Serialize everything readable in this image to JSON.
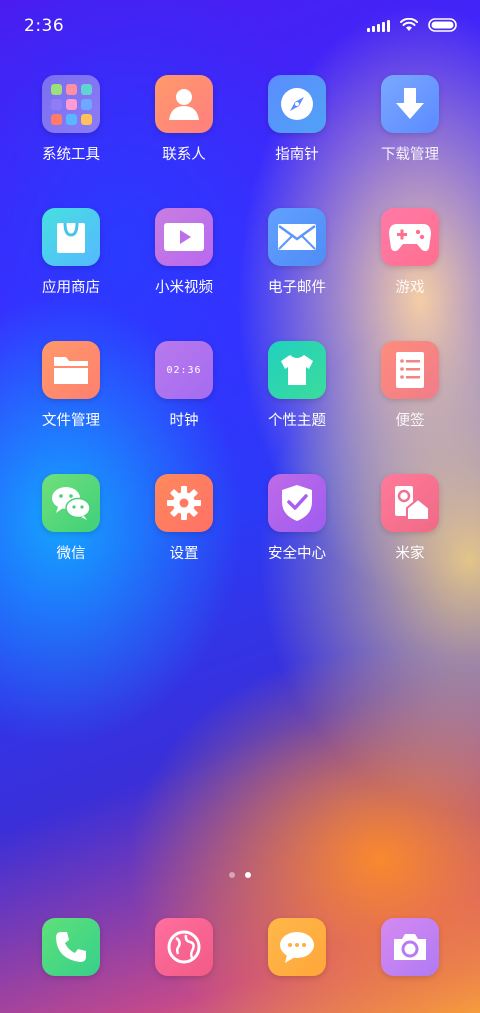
{
  "status_bar": {
    "time": "2:36"
  },
  "apps": [
    {
      "label": "系统工具",
      "icon": "folder-icon"
    },
    {
      "label": "联系人",
      "icon": "contacts-icon"
    },
    {
      "label": "指南针",
      "icon": "compass-icon"
    },
    {
      "label": "下载管理",
      "icon": "download-icon"
    },
    {
      "label": "应用商店",
      "icon": "shopping-bag-icon"
    },
    {
      "label": "小米视频",
      "icon": "video-icon"
    },
    {
      "label": "电子邮件",
      "icon": "mail-icon"
    },
    {
      "label": "游戏",
      "icon": "gamepad-icon"
    },
    {
      "label": "文件管理",
      "icon": "file-folder-icon"
    },
    {
      "label": "时钟",
      "icon": "clock-icon",
      "clock_text": "02:36"
    },
    {
      "label": "个性主题",
      "icon": "tshirt-icon"
    },
    {
      "label": "便签",
      "icon": "notes-icon"
    },
    {
      "label": "微信",
      "icon": "wechat-icon"
    },
    {
      "label": "设置",
      "icon": "gear-icon"
    },
    {
      "label": "安全中心",
      "icon": "shield-icon"
    },
    {
      "label": "米家",
      "icon": "smart-home-icon"
    }
  ],
  "dock": [
    {
      "icon": "phone-icon"
    },
    {
      "icon": "browser-icon"
    },
    {
      "icon": "message-icon"
    },
    {
      "icon": "camera-icon"
    }
  ],
  "page_indicator": {
    "pages": 2,
    "current": 2
  }
}
